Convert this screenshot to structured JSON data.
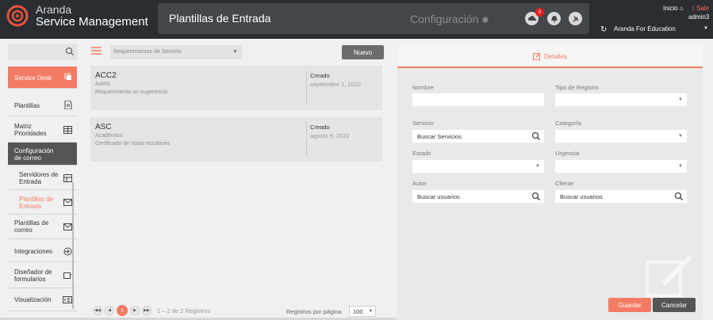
{
  "header": {
    "brand_top": "Aranda",
    "brand_bottom": "Service Management",
    "page_title": "Plantillas de Entrada",
    "config_title": "Configuración",
    "notification_count": "0",
    "inicio": "Inicio",
    "separator": "|",
    "salir": "Salir",
    "user": "admin3",
    "organization": "Aranda For Education"
  },
  "sidebar": {
    "service_desk": "Service Desk",
    "items": [
      "Plantillas",
      "Matriz Prioridades"
    ],
    "config_header": "Configuración de correo",
    "sub_items": [
      "Servidores de Entrada",
      "Plantillas de Entrada"
    ],
    "items_after": [
      "Plantillas de correo",
      "Integraciones",
      "Diseñador de formularios",
      "Visualización"
    ]
  },
  "list": {
    "type_select": "Requerimientos de Servicio",
    "new_button": "Nuevo",
    "cards": [
      {
        "code": "ACC2",
        "sub1": "AsMS",
        "sub2": "Requerimiento so sugerencia",
        "created_label": "Creado",
        "date": "septiembre 1, 2022"
      },
      {
        "code": "ASC",
        "sub1": "Académico",
        "sub2": "Certificado de notas escolares",
        "created_label": "Creado",
        "date": "agosto 9, 2022"
      }
    ],
    "pager": {
      "current": "1",
      "info": "1 – 2 de 2 Registros",
      "per_page_label": "Registros por página:",
      "per_page": "100"
    }
  },
  "panel": {
    "tab": "Detalles",
    "fields": {
      "nombre": "Nombre",
      "tipo_registro": "Tipo de Registro",
      "servicio": "Servicio",
      "servicio_value": "Buscar Servicios",
      "categoria": "Categoría",
      "estado": "Estado",
      "urgencia": "Urgencia",
      "autor": "Autor",
      "autor_value": "Buscar usuarios",
      "cliente": "Cliente",
      "cliente_value": "Buscar usuarios"
    },
    "save": "Guardar",
    "cancel": "Cancelar"
  },
  "colors": {
    "accent": "#f47b63",
    "dark": "#2a2d31",
    "notification": "#e02020"
  }
}
